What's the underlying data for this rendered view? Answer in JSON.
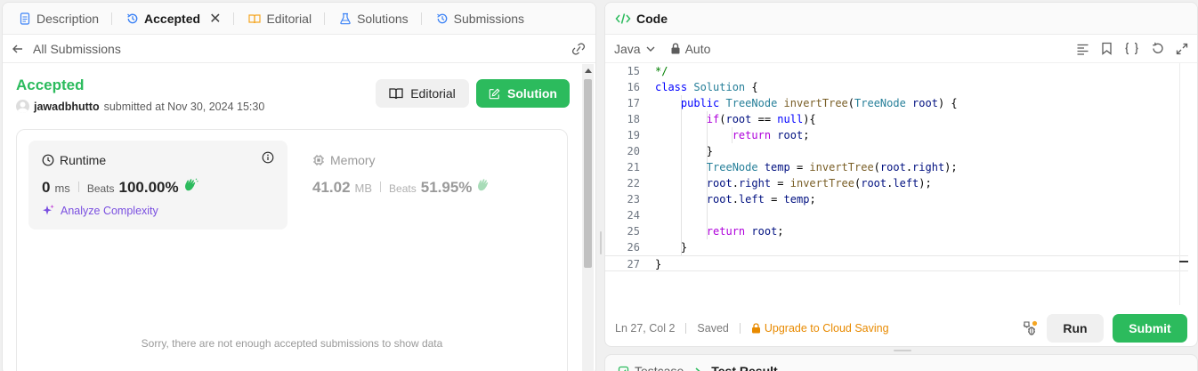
{
  "left_tabs": [
    {
      "label": "Description"
    },
    {
      "label": "Accepted"
    },
    {
      "label": "Editorial"
    },
    {
      "label": "Solutions"
    },
    {
      "label": "Submissions"
    }
  ],
  "subbar": {
    "back_label": "All Submissions"
  },
  "submission": {
    "status": "Accepted",
    "username": "jawadbhutto",
    "submitted_text": "submitted at Nov 30, 2024 15:30"
  },
  "buttons": {
    "editorial": "Editorial",
    "solution": "Solution"
  },
  "runtime": {
    "label": "Runtime",
    "value": "0",
    "unit": "ms",
    "beats_label": "Beats",
    "beats_pct": "100.00%",
    "analyze": "Analyze Complexity"
  },
  "memory": {
    "label": "Memory",
    "value": "41.02",
    "unit": "MB",
    "beats_label": "Beats",
    "beats_pct": "51.95%"
  },
  "empty_message": "Sorry, there are not enough accepted submissions to show data",
  "code_panel": {
    "title": "Code",
    "language": "Java",
    "mode": "Auto",
    "lines": [
      {
        "n": "15",
        "html": "<span class='cm'>*/</span>"
      },
      {
        "n": "16",
        "html": "<span class='kw'>class</span> <span class='ty'>Solution</span> {"
      },
      {
        "n": "17",
        "html": "    <span class='kw'>public</span> <span class='ty'>TreeNode</span> <span class='fn'>invertTree</span>(<span class='ty'>TreeNode</span> <span class='var'>root</span>) {"
      },
      {
        "n": "18",
        "html": "        <span class='kw2'>if</span>(<span class='var'>root</span> == <span class='kw'>null</span>){"
      },
      {
        "n": "19",
        "html": "            <span class='kw2'>return</span> <span class='var'>root</span>;"
      },
      {
        "n": "20",
        "html": "        }"
      },
      {
        "n": "21",
        "html": "        <span class='ty'>TreeNode</span> <span class='var'>temp</span> = <span class='fn'>invertTree</span>(<span class='var'>root</span>.<span class='var'>right</span>);"
      },
      {
        "n": "22",
        "html": "        <span class='var'>root</span>.<span class='var'>right</span> = <span class='fn'>invertTree</span>(<span class='var'>root</span>.<span class='var'>left</span>);"
      },
      {
        "n": "23",
        "html": "        <span class='var'>root</span>.<span class='var'>left</span> = <span class='var'>temp</span>;"
      },
      {
        "n": "24",
        "html": ""
      },
      {
        "n": "25",
        "html": "        <span class='kw2'>return</span> <span class='var'>root</span>;"
      },
      {
        "n": "26",
        "html": "    }"
      },
      {
        "n": "27",
        "html": "}"
      }
    ]
  },
  "status_bar": {
    "position": "Ln 27, Col 2",
    "saved": "Saved",
    "upgrade": "Upgrade to Cloud Saving"
  },
  "actions": {
    "run": "Run",
    "submit": "Submit"
  },
  "bottom_tabs": [
    {
      "label": "Testcase"
    },
    {
      "label": "Test Result"
    }
  ],
  "colors": {
    "accent_green": "#2cbb5d",
    "analyze_purple": "#7a4fe0",
    "upgrade_orange": "#e88a00"
  }
}
